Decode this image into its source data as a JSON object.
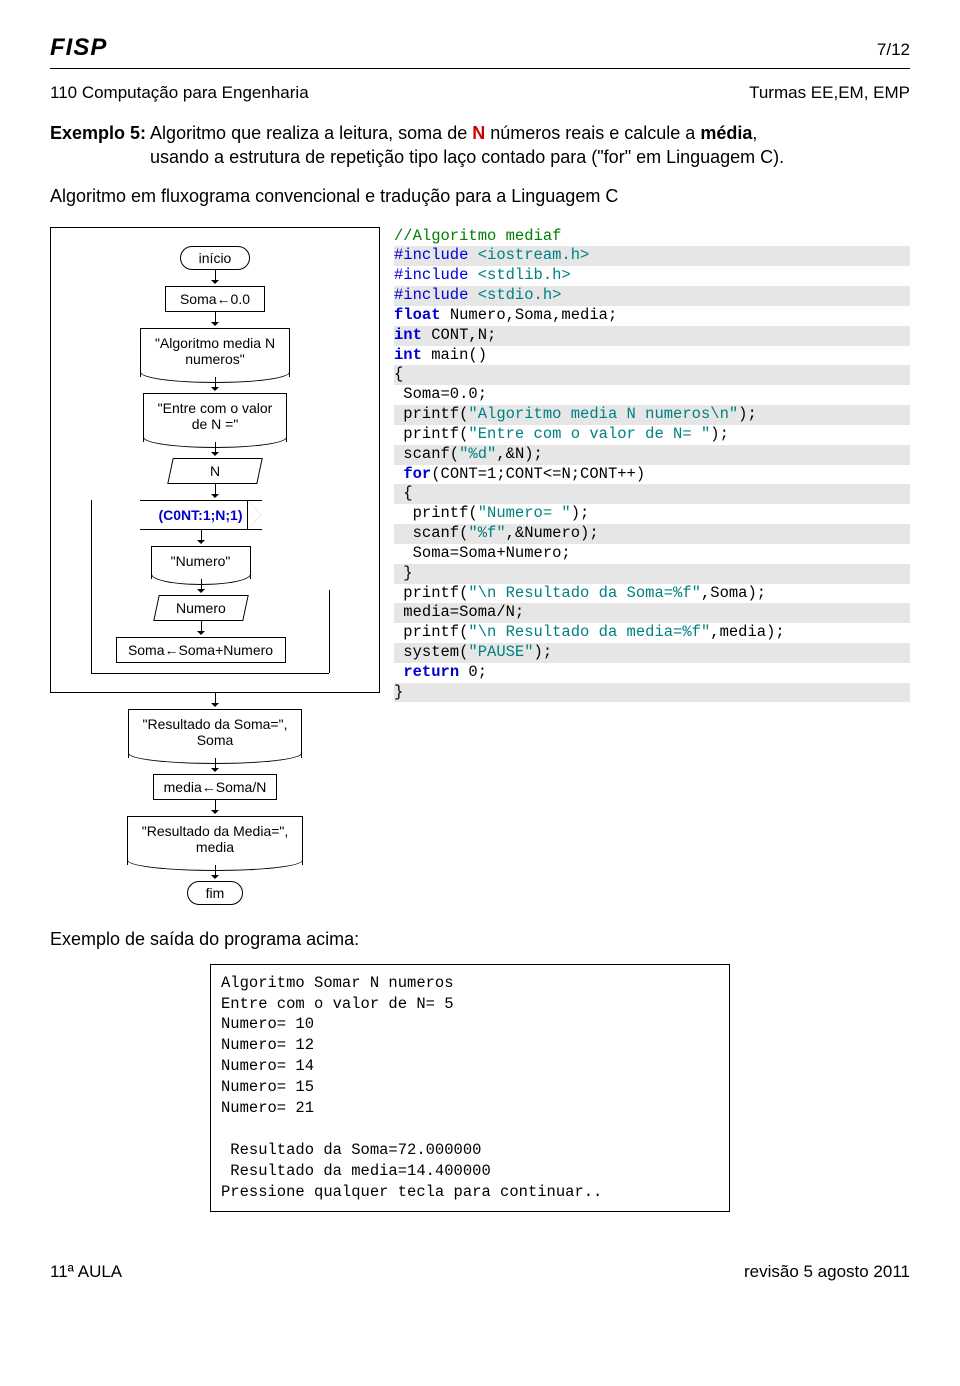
{
  "header": {
    "fisp": "FISP",
    "page": "7/12",
    "course": "110 Computação para Engenharia",
    "turmas": "Turmas EE,EM, EMP"
  },
  "intro": {
    "exLabel": "Exemplo 5:",
    "line1a": "Algoritmo que realiza a leitura, soma de ",
    "N": "N",
    "line1b": " números reais e calcule a ",
    "media": "média",
    "line1c": ",",
    "line2": "usando a estrutura de repetição tipo laço contado para (\"for\" em Linguagem C).",
    "line3": "Algoritmo em fluxograma convencional e tradução para a Linguagem C"
  },
  "fc": {
    "inicio": "início",
    "soma0": "Soma←0.0",
    "disp1a": "\"Algoritmo media N",
    "disp1b": "numeros\"",
    "disp2a": "\"Entre com o valor",
    "disp2b": "de N =\"",
    "readN": "N",
    "hex": "(C0NT:1;N;1)",
    "dispNumero": "\"Numero\"",
    "readNumero": "Numero",
    "somaAcc": "Soma←Soma+Numero",
    "dispResSoma1": "\"Resultado da Soma=\",",
    "dispResSoma2": "Soma",
    "mediaCalc": "media←Soma/N",
    "dispResMedia1": "\"Resultado da Media=\",",
    "dispResMedia2": "media",
    "fim": "fim"
  },
  "code": {
    "l1": "//Algoritmo mediaf",
    "l2a": "#include ",
    "l2b": "<iostream.h>",
    "l3a": "#include ",
    "l3b": "<stdlib.h>",
    "l4a": "#include ",
    "l4b": "<stdio.h>",
    "l5a": "float",
    "l5b": " Numero,Soma,media;",
    "l6a": "int",
    "l6b": " CONT,N;",
    "l7a": "int",
    "l7b": " main()",
    "l8": "{",
    "l9": " Soma=0.0;",
    "l10a": " printf(",
    "l10b": "\"Algoritmo media N numeros\\n\"",
    "l10c": ");",
    "l11a": " printf(",
    "l11b": "\"Entre com o valor de N= \"",
    "l11c": ");",
    "l12a": " scanf(",
    "l12b": "\"%d\"",
    "l12c": ",&N);",
    "l13a": " ",
    "l13b": "for",
    "l13c": "(CONT=1;CONT<=N;CONT++)",
    "l14": " {",
    "l15a": "  printf(",
    "l15b": "\"Numero= \"",
    "l15c": ");",
    "l16a": "  scanf(",
    "l16b": "\"%f\"",
    "l16c": ",&Numero);",
    "l17": "  Soma=Soma+Numero;",
    "l18": " }",
    "l19a": " printf(",
    "l19b": "\"\\n Resultado da Soma=%f\"",
    "l19c": ",Soma);",
    "l20": " media=Soma/N;",
    "l21a": " printf(",
    "l21b": "\"\\n Resultado da media=%f\"",
    "l21c": ",media);",
    "l22a": " system(",
    "l22b": "\"PAUSE\"",
    "l22c": ");",
    "l23a": " ",
    "l23b": "return",
    "l23c": " 0;",
    "l24": "}"
  },
  "outTitle": "Exemplo de saída do programa acima:",
  "out": {
    "l1": "Algoritmo Somar N numeros",
    "l2": "Entre com o valor de N= 5",
    "l3": "Numero= 10",
    "l4": "Numero= 12",
    "l5": "Numero= 14",
    "l6": "Numero= 15",
    "l7": "Numero= 21",
    "blank": "",
    "l8": " Resultado da Soma=72.000000",
    "l9": " Resultado da media=14.400000",
    "l10": "Pressione qualquer tecla para continuar.."
  },
  "footer": {
    "aula": "11ª AULA",
    "rev": "revisão 5 agosto 2011"
  }
}
